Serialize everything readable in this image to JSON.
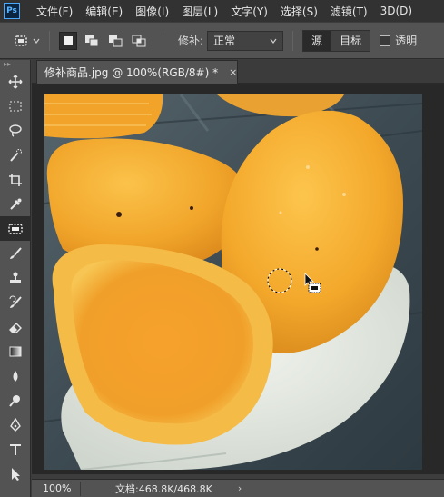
{
  "menubar": {
    "logo_text": "Ps",
    "items": [
      "文件(F)",
      "编辑(E)",
      "图像(I)",
      "图层(L)",
      "文字(Y)",
      "选择(S)",
      "滤镜(T)",
      "3D(D)"
    ]
  },
  "options": {
    "patch_label": "修补:",
    "patch_mode": "正常",
    "source_label": "源",
    "target_label": "目标",
    "transparent_label": "透明"
  },
  "document": {
    "tab_title": "修补商品.jpg @ 100%(RGB/8#) *",
    "close_glyph": "×"
  },
  "status": {
    "zoom": "100%",
    "doc_info": "文档:468.8K/468.8K",
    "arrow": "›"
  },
  "tools": [
    "move-icon",
    "marquee-icon",
    "lasso-icon",
    "quick-select-icon",
    "crop-icon",
    "eyedropper-icon",
    "patch-icon",
    "brush-icon",
    "stamp-icon",
    "history-brush-icon",
    "eraser-icon",
    "gradient-icon",
    "blur-icon",
    "dodge-icon",
    "pen-icon",
    "type-icon",
    "path-select-icon"
  ],
  "colors": {
    "ui_dark": "#323232",
    "ui_panel": "#535353",
    "mango": "#f2a72a",
    "plate": "#e6ebe4",
    "table": "#3f4c55"
  }
}
